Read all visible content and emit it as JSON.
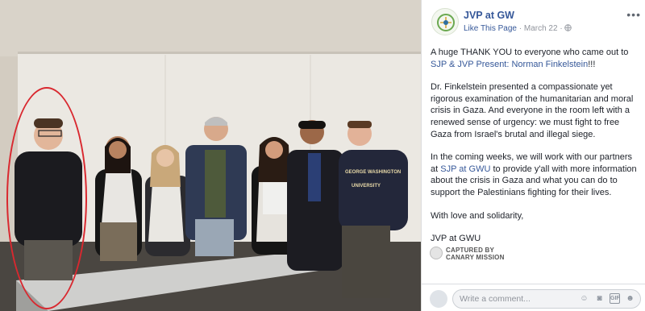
{
  "post": {
    "page_name": "JVP at GW",
    "like_label": "Like This Page",
    "date": "March 22",
    "privacy_icon": "globe-icon",
    "more_icon": "ellipsis-icon",
    "paragraph1_pre": "A huge THANK YOU to everyone who came out to",
    "paragraph1_link": "SJP & JVP Present: Norman Finkelstein",
    "paragraph1_post": "!!!",
    "paragraph2": "Dr. Finkelstein presented a compassionate yet rigorous examination of the humanitarian and moral crisis in Gaza. And everyone in the room left with a renewed sense of urgency: we must fight to free Gaza from Israel's brutal and illegal siege.",
    "paragraph3_pre": "In the coming weeks, we will work with our partners at",
    "paragraph3_link": "SJP at GWU",
    "paragraph3_post": "to provide y'all with more information about the crisis in Gaza and what you can do to support the Palestinians fighting for their lives.",
    "paragraph4": "With love and solidarity,",
    "paragraph5": "JVP at GWU"
  },
  "watermark": {
    "line1": "CAPTURED BY",
    "line2": "CANARY MISSION"
  },
  "comment": {
    "placeholder": "Write a comment...",
    "icons": [
      "emoji-icon",
      "camera-icon",
      "gif-icon",
      "sticker-icon"
    ]
  },
  "photo": {
    "shirt_line1": "GEORGE WASHINGTON",
    "shirt_line2": "UNIVERSITY"
  },
  "colors": {
    "link": "#365899",
    "annotation": "#d9282f"
  }
}
